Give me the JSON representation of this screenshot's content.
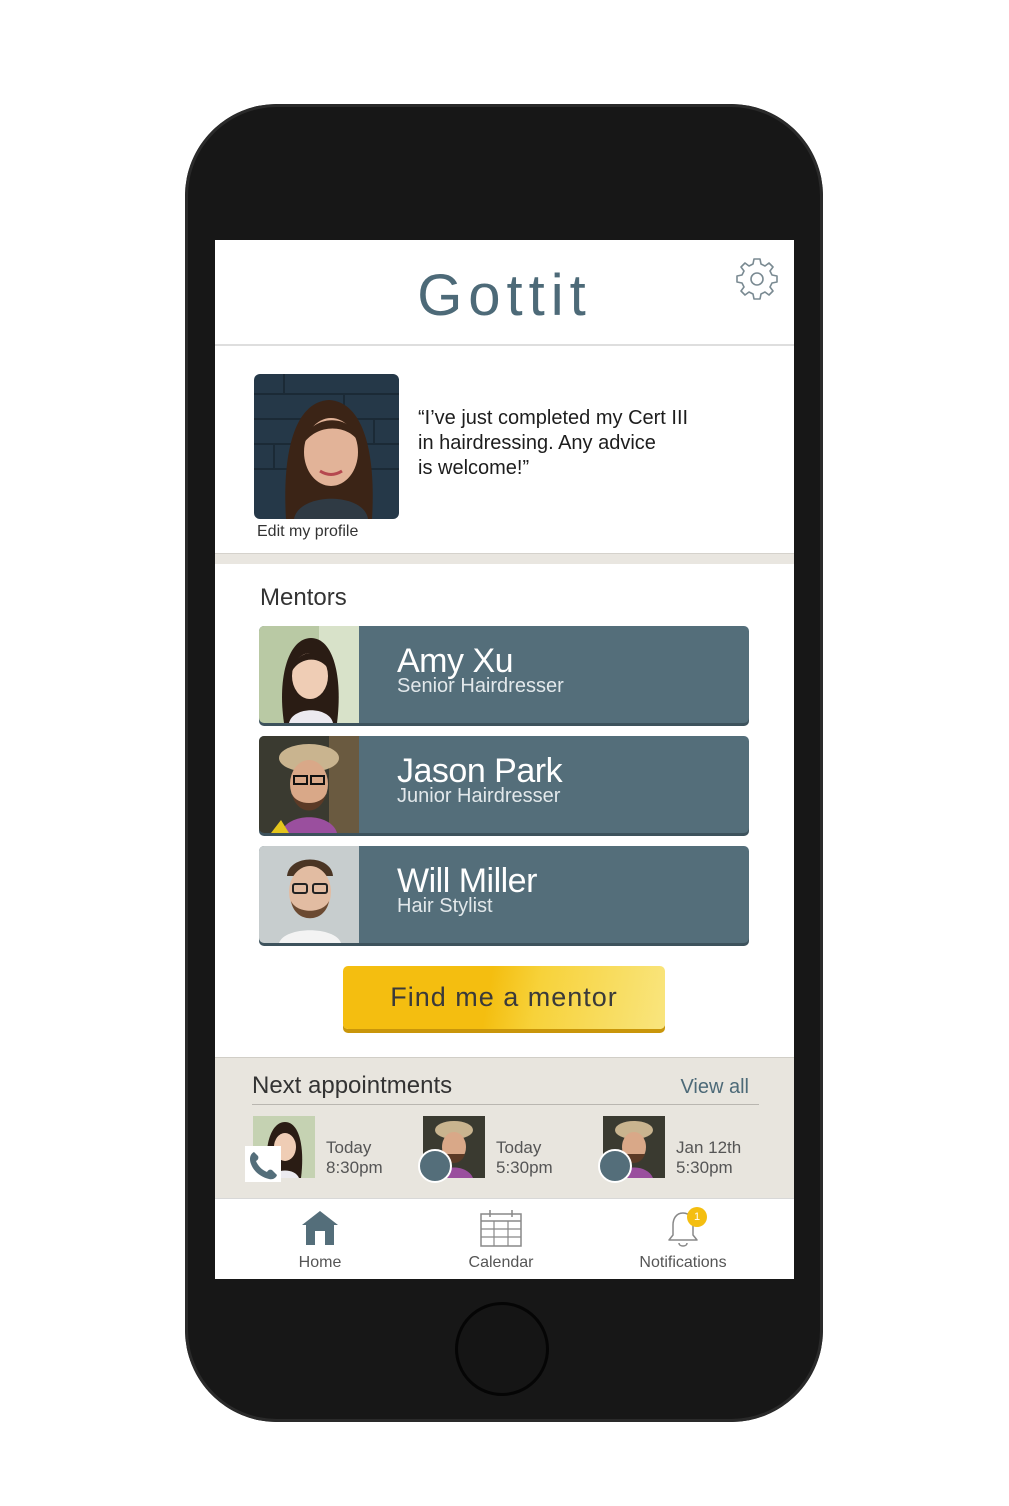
{
  "app": {
    "title": "Gottit",
    "gear_icon": "gear-icon"
  },
  "profile": {
    "quote": "“I’ve just completed my Cert III\n in hairdressing. Any advice\n is welcome!”",
    "edit_label": "Edit my profile"
  },
  "mentors": {
    "title": "Mentors",
    "items": [
      {
        "name": "Amy Xu",
        "role": "Senior Hairdresser"
      },
      {
        "name": "Jason Park",
        "role": "Junior Hairdresser"
      },
      {
        "name": "Will Miller",
        "role": "Hair Stylist"
      }
    ],
    "find_button": "Find me a mentor"
  },
  "appointments": {
    "title": "Next appointments",
    "view_all": "View all",
    "items": [
      {
        "day": "Today",
        "time": "8:30pm",
        "type": "phone-icon"
      },
      {
        "day": "Today",
        "time": "5:30pm",
        "type": "chat-icon"
      },
      {
        "day": "Jan 12th",
        "time": "5:30pm",
        "type": "chat-icon"
      }
    ]
  },
  "tabs": {
    "home": "Home",
    "calendar": "Calendar",
    "notifications": "Notifications",
    "notification_count": "1"
  },
  "colors": {
    "brand": "#4d6a78",
    "card": "#546e7a",
    "accent": "#f4be10",
    "band": "#e8e5de"
  }
}
